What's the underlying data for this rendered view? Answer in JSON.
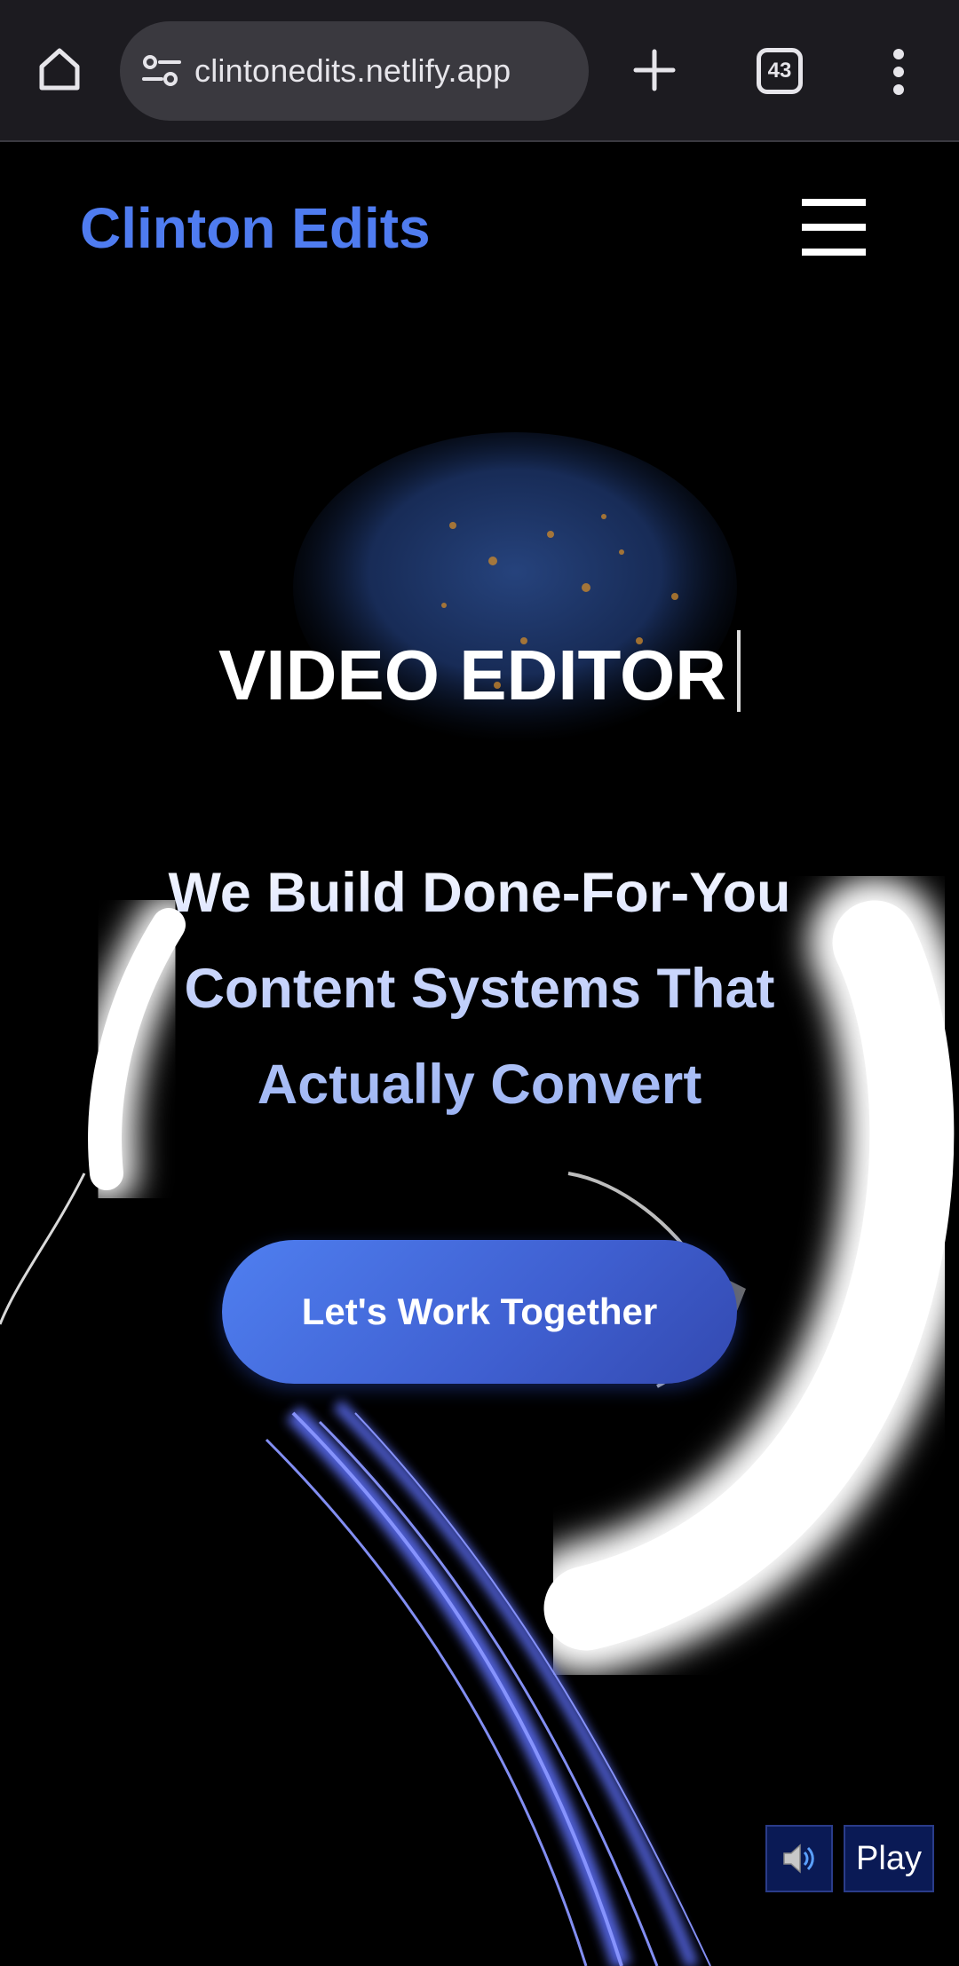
{
  "browser": {
    "url": "clintonedits.netlify.app",
    "tab_count": "43",
    "icons": [
      "home-icon",
      "site-info-icon",
      "plus-icon",
      "tabs-icon",
      "more-vert-icon"
    ]
  },
  "header": {
    "brand": "Clinton Edits",
    "menu_icon": "hamburger-icon"
  },
  "hero": {
    "title": "VIDEO EDITOR",
    "tagline": "We Build Done-For-You Content Systems That Actually Convert",
    "cta_label": "Let's Work Together"
  },
  "media_controls": {
    "sound_icon": "speaker-icon",
    "play_label": "Play"
  },
  "colors": {
    "brand": "#4f7cf0",
    "browser_bg": "#1c1b20",
    "cta": "#4a72e6"
  }
}
